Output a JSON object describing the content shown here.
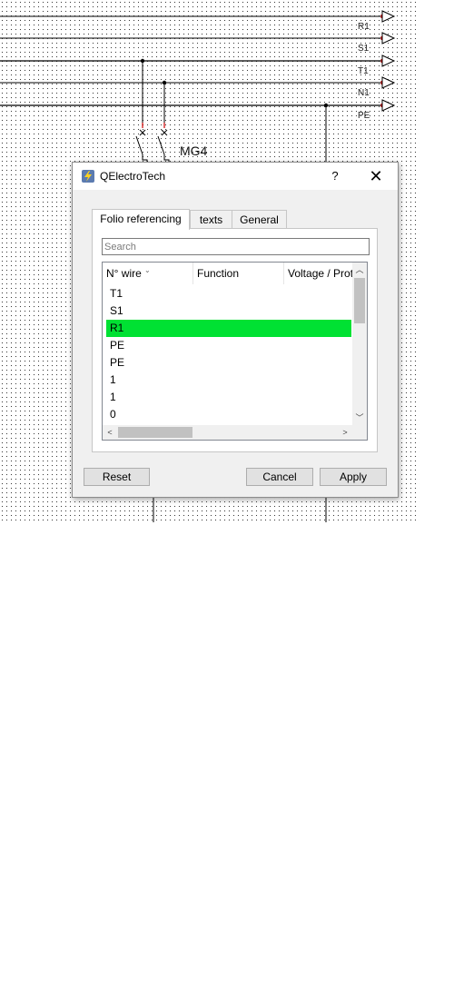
{
  "schematic": {
    "net_labels": [
      "R1",
      "S1",
      "T1",
      "N1",
      "PE"
    ],
    "component_label": "MG4"
  },
  "dialog": {
    "title": "QElectroTech",
    "help_label": "?",
    "close_label": "✕",
    "app_icon": "qelectrotech-logo-icon",
    "tabs": [
      {
        "label": "Folio referencing",
        "active": true
      },
      {
        "label": "texts",
        "active": false
      },
      {
        "label": "General",
        "active": false
      }
    ],
    "search": {
      "placeholder": "Search",
      "value": ""
    },
    "table": {
      "columns": [
        "N° wire",
        "Function",
        "Voltage / Prot"
      ],
      "rows": [
        {
          "wire": "T1",
          "function": "",
          "voltage": "",
          "selected": false
        },
        {
          "wire": "S1",
          "function": "",
          "voltage": "",
          "selected": false
        },
        {
          "wire": "R1",
          "function": "",
          "voltage": "",
          "selected": true
        },
        {
          "wire": "PE",
          "function": "",
          "voltage": "",
          "selected": false
        },
        {
          "wire": "PE",
          "function": "",
          "voltage": "",
          "selected": false
        },
        {
          "wire": "1",
          "function": "",
          "voltage": "",
          "selected": false
        },
        {
          "wire": "1",
          "function": "",
          "voltage": "",
          "selected": false
        },
        {
          "wire": "0",
          "function": "",
          "voltage": "",
          "selected": false
        }
      ],
      "selection_color": "#00e133"
    },
    "buttons": {
      "reset": "Reset",
      "cancel": "Cancel",
      "apply": "Apply"
    }
  }
}
